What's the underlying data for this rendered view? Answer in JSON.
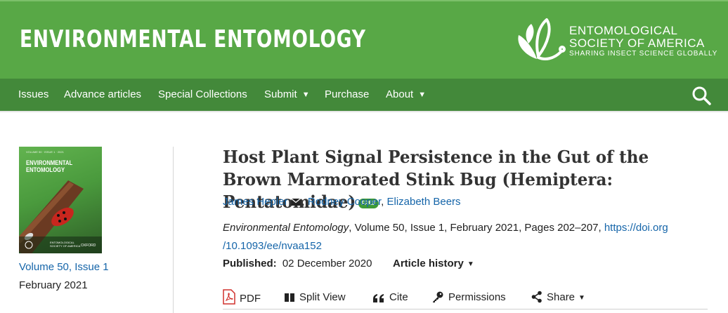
{
  "header": {
    "journal_title": "ENVIRONMENTAL ENTOMOLOGY",
    "society_line1": "ENTOMOLOGICAL",
    "society_line2": "SOCIETY OF AMERICA",
    "society_tagline": "SHARING INSECT SCIENCE GLOBALLY",
    "brand_green": "#58a846",
    "nav_green": "#43893a"
  },
  "nav": {
    "issues": "Issues",
    "advance": "Advance articles",
    "special": "Special Collections",
    "submit": "Submit",
    "purchase": "Purchase",
    "about": "About",
    "search_icon": "search-icon"
  },
  "cover": {
    "top_text": "VOLUME 50 · ISSUE 1 · 2021",
    "title_line1": "ENVIRONMENTAL",
    "title_line2": "ENTOMOLOGY",
    "bottom_line1": "ENTOMOLOGICAL",
    "bottom_line2": "SOCIETY OF AMERICA",
    "publisher": "OXFORD"
  },
  "issue": {
    "volume_link": "Volume 50, Issue 1",
    "date": "February 2021"
  },
  "article": {
    "title": "Host Plant Signal Persistence in the Gut of the Brown Marmorated Stink Bug (Hemiptera: Pentatomidae)",
    "free_badge": "FREE",
    "authors": [
      "James Hepler",
      "Rodney Cooper",
      "Elizabeth Beers"
    ],
    "author_sep": ", ",
    "journal_name": "Environmental Entomology",
    "citation_rest": ", Volume 50, Issue 1, February 2021, Pages 202–207, ",
    "doi_part1": "https://doi.org",
    "doi_part2": "/10.1093/ee/nvaa152",
    "published_label": "Published:",
    "published_date": "02 December 2020",
    "history_label": "Article history"
  },
  "tools": {
    "pdf": "PDF",
    "split": "Split View",
    "cite": "Cite",
    "permissions": "Permissions",
    "share": "Share"
  }
}
